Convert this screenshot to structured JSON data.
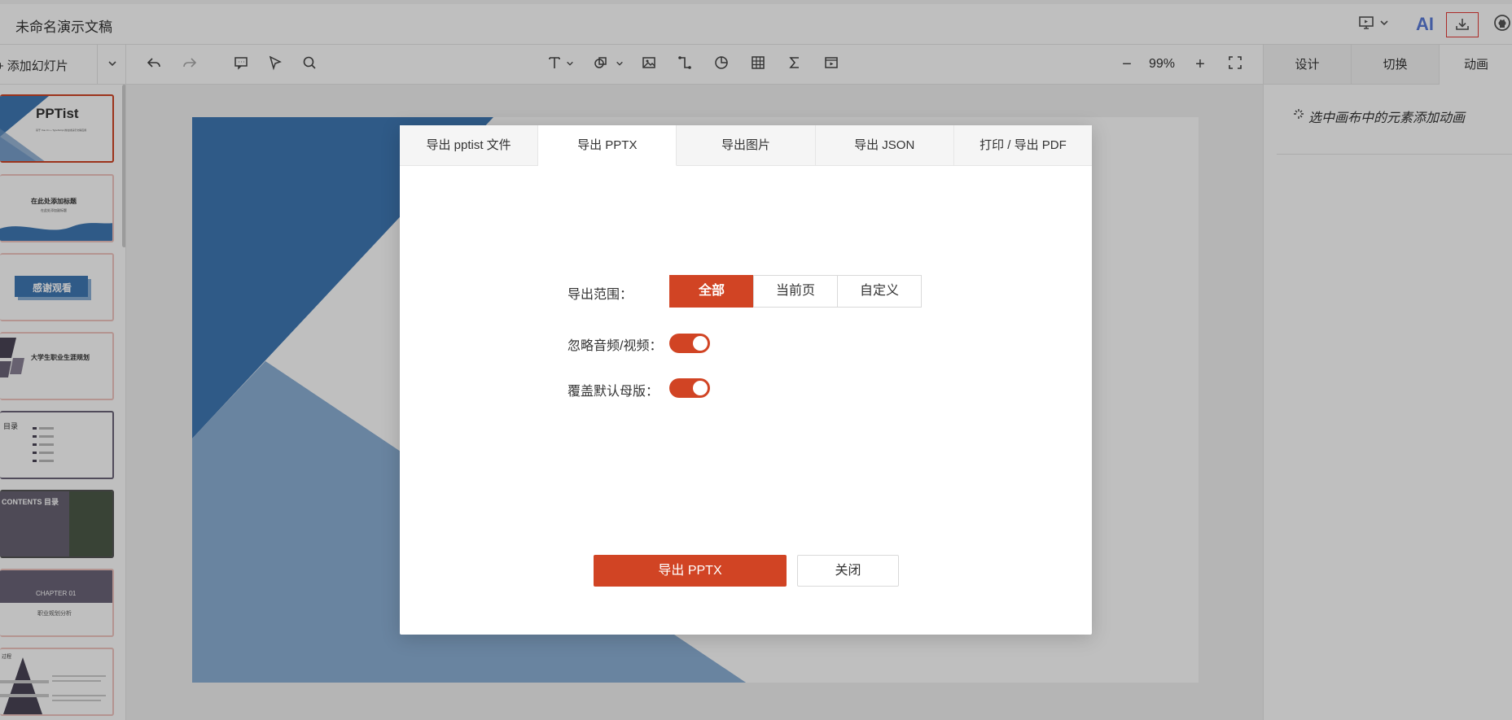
{
  "app": {
    "doc_title": "未命名演示文稿",
    "ai_label": "AI",
    "icons": [
      "presentation-icon",
      "chevron-down-icon",
      "download-icon",
      "github-icon"
    ]
  },
  "toolbar": {
    "add_slide_label": "添加幻灯片",
    "zoom": "99%",
    "minus": "−",
    "plus": "+"
  },
  "right_panel": {
    "tabs": [
      {
        "label": "设计",
        "active": false
      },
      {
        "label": "切换",
        "active": false
      },
      {
        "label": "动画",
        "active": true
      }
    ],
    "hint": "选中画布中的元素添加动画"
  },
  "thumbnails": [
    {
      "title": "PPTist",
      "subtitle": "基于 Vue 3.x + TypeScript 的在线演示文稿应用"
    },
    {
      "title": "在此处添加标题",
      "subtitle": "在此处添加副标题"
    },
    {
      "title": "感谢观看"
    },
    {
      "title": "大学生职业生涯规划"
    },
    {
      "title": "目录"
    },
    {
      "title": "CONTENTS 目录"
    },
    {
      "title": "CHAPTER 01",
      "subtitle": "职业规划分析"
    },
    {
      "title": "过程"
    }
  ],
  "dialog": {
    "tabs": [
      {
        "label": "导出 pptist 文件",
        "active": false
      },
      {
        "label": "导出 PPTX",
        "active": true
      },
      {
        "label": "导出图片",
        "active": false
      },
      {
        "label": "导出 JSON",
        "active": false
      },
      {
        "label": "打印 / 导出 PDF",
        "active": false
      }
    ],
    "range_label": "导出范围：",
    "range_options": [
      {
        "label": "全部",
        "active": true
      },
      {
        "label": "当前页",
        "active": false
      },
      {
        "label": "自定义",
        "active": false
      }
    ],
    "ignore_media_label": "忽略音频/视频：",
    "ignore_media_on": true,
    "override_master_label": "覆盖默认母版：",
    "override_master_on": true,
    "export_button": "导出 PPTX",
    "close_button": "关闭"
  },
  "colors": {
    "accent": "#d14424",
    "slide_blue_dark": "#3f78b4",
    "slide_blue_light": "#8db0d6",
    "ai": "#5a7bd8"
  }
}
